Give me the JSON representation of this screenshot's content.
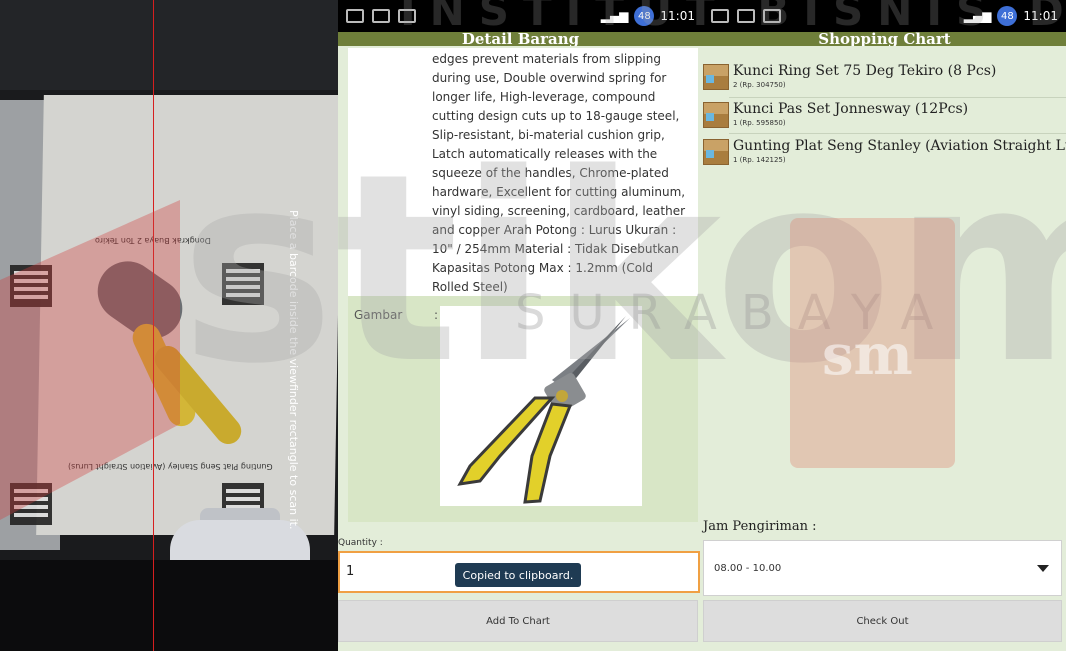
{
  "status_time": "11:01",
  "status_badge": "48",
  "detail": {
    "title": "Detail Barang",
    "description": "edges prevent materials from slipping during use, Double overwind spring for longer life, High-leverage, compound cutting design cuts up to 18-gauge steel, Slip-resistant, bi-material cushion grip, Latch automatically releases with the squeeze of the handles, Chrome-plated hardware, Excellent for cutting aluminum, vinyl siding, screening, cardboard, leather and copper Arah Potong : Lurus Ukuran : 10\" / 254mm Material : Tidak Disebutkan Kapasitas Potong Max : 1.2mm (Cold Rolled Steel)",
    "image_label": "Gambar",
    "image_colon": ":",
    "quantity_label": "Quantity :",
    "quantity_value": "1",
    "toast": "Copied to clipboard.",
    "add_button": "Add To Chart"
  },
  "cart": {
    "title": "Shopping Chart",
    "items": [
      {
        "name": "Kunci Ring Set 75 Deg Tekiro (8 Pcs)",
        "detail": "2 (Rp. 304750)"
      },
      {
        "name": "Kunci Pas Set Jonnesway (12Pcs)",
        "detail": "1 (Rp. 595850)"
      },
      {
        "name": "Gunting Plat Seng Stanley (Aviation Straight Lurus)",
        "detail": "1 (Rp. 142125)"
      }
    ],
    "jam_label": "Jam Pengiriman :",
    "jam_value": "08.00 - 10.00",
    "checkout_button": "Check Out"
  },
  "camera": {
    "instruction": "Place a barcode inside the viewfinder rectangle to scan it.",
    "label_top": "Dongkrak Buaya 2 Ton Tekiro",
    "label_bottom": "Gunting Plat Seng Stanley (Aviation Straight Lurus)"
  },
  "watermark": {
    "top": "INSTITUT BISNIS DAN INFORMATIKA",
    "big": "stikom",
    "sub": "SURABAYA",
    "logo": "sm"
  }
}
